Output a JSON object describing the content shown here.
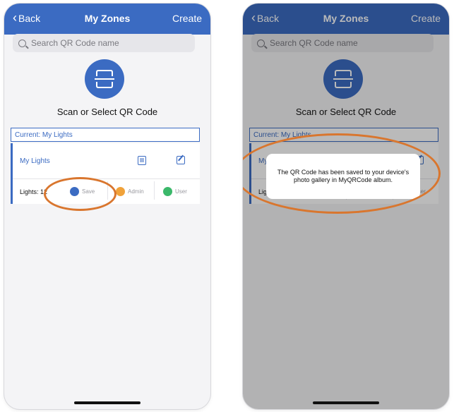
{
  "nav": {
    "back_label": "Back",
    "title": "My Zones",
    "create_label": "Create"
  },
  "search": {
    "placeholder": "Search QR Code name"
  },
  "scan": {
    "label": "Scan or Select QR Code"
  },
  "current": {
    "label": "Current: My Lights"
  },
  "card": {
    "name": "My Lights",
    "lights_label": "Lights: 12",
    "actions": [
      {
        "label": "Save",
        "color": "#3b6bc2"
      },
      {
        "label": "Admin",
        "color": "#f0a23a"
      },
      {
        "label": "User",
        "color": "#3bb86a"
      }
    ]
  },
  "toast": {
    "message": "The QR Code has been saved to your device's photo gallery in MyQRCode album."
  },
  "colors": {
    "accent": "#3b6bc2",
    "highlight_ring": "#d9762e"
  }
}
